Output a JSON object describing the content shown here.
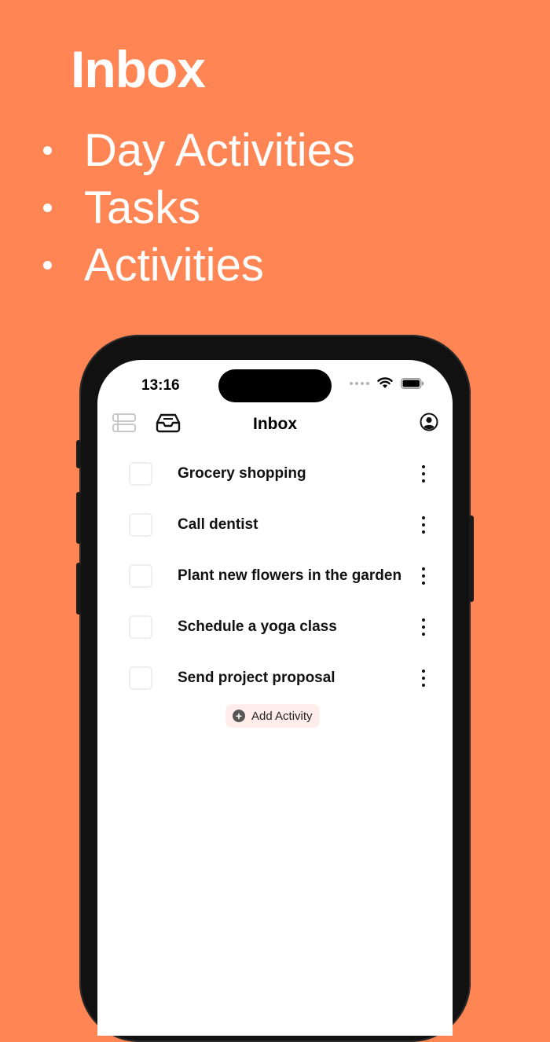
{
  "promo": {
    "title": "Inbox",
    "bullets": [
      "Day Activities",
      "Tasks",
      "Activities"
    ]
  },
  "status_bar": {
    "time": "13:16"
  },
  "nav": {
    "title": "Inbox",
    "left_icons": [
      "sidebar-list-icon",
      "inbox-tray-icon"
    ],
    "right_icon": "profile-icon"
  },
  "tasks": [
    {
      "label": "Grocery shopping",
      "checked": false
    },
    {
      "label": "Call dentist",
      "checked": false
    },
    {
      "label": "Plant new flowers in the garden",
      "checked": false
    },
    {
      "label": "Schedule a yoga class",
      "checked": false
    },
    {
      "label": "Send project proposal",
      "checked": false
    }
  ],
  "add_button": {
    "label": "Add Activity"
  },
  "colors": {
    "background": "#FF8654",
    "add_button_bg": "#FFEDEB"
  }
}
